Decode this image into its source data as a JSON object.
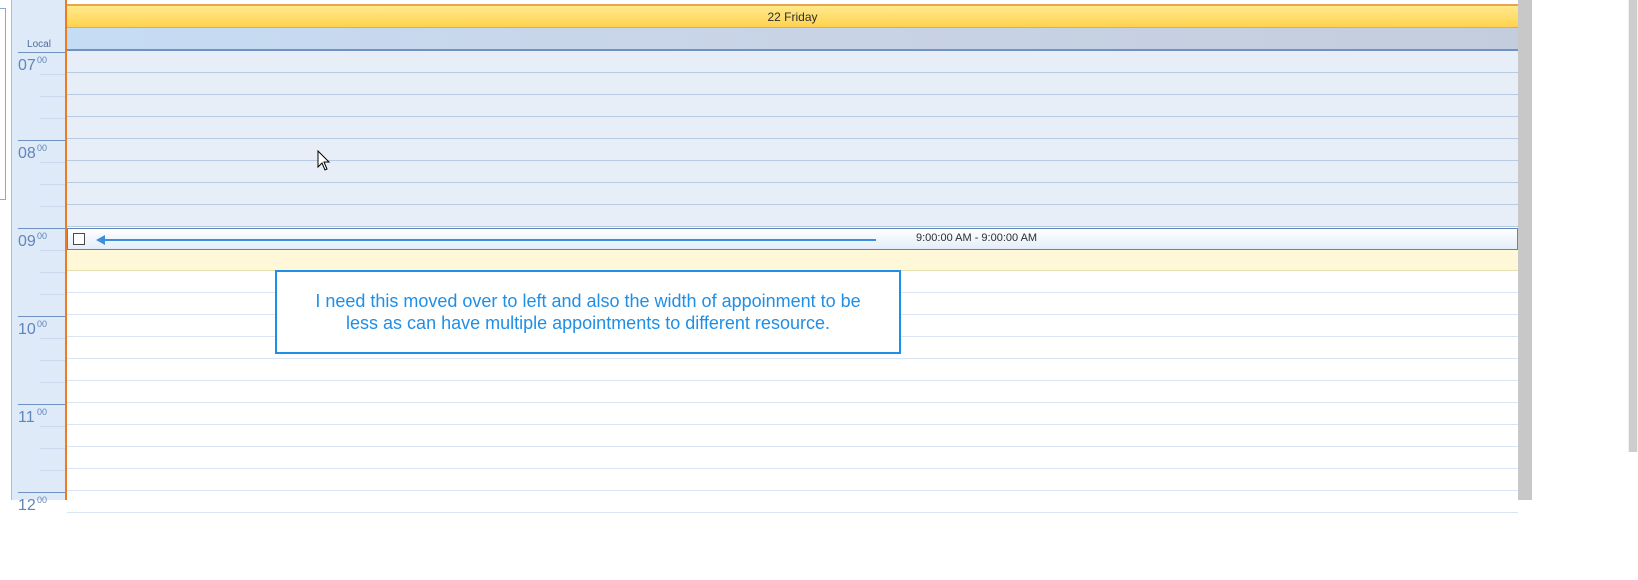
{
  "day_header": {
    "label": "22 Friday"
  },
  "time_ruler": {
    "timezone_label": "Local",
    "hours": [
      {
        "hh": "07",
        "mm": "00"
      },
      {
        "hh": "08",
        "mm": "00"
      },
      {
        "hh": "09",
        "mm": "00"
      },
      {
        "hh": "10",
        "mm": "00"
      },
      {
        "hh": "11",
        "mm": "00"
      },
      {
        "hh": "12",
        "mm": "00"
      }
    ]
  },
  "appointment": {
    "time_range": "9:00:00 AM - 9:00:00 AM"
  },
  "callout": {
    "text": "I need this moved over to left and also the width of appoinment to be less as can have multiple appointments to different resource."
  },
  "colors": {
    "header_yellow": "#ffd24f",
    "today_marker": "#f07a1e",
    "off_hours": "#e7eef8",
    "callout_blue": "#1f8fe6"
  }
}
